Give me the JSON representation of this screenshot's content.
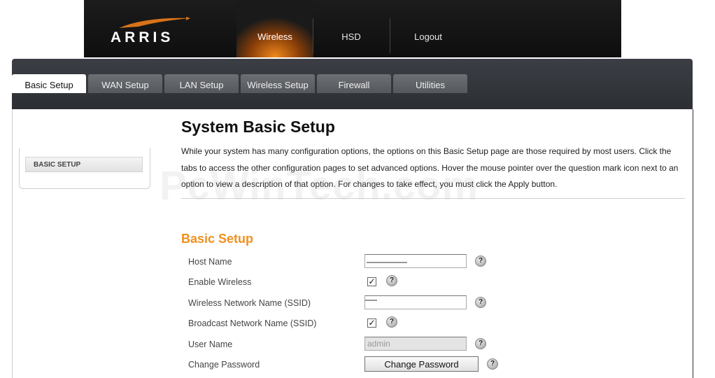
{
  "header": {
    "logo_text": "ARRIS",
    "nav": [
      {
        "label": "Wireless",
        "active": true
      },
      {
        "label": "HSD",
        "active": false
      },
      {
        "label": "Logout",
        "active": false
      }
    ]
  },
  "tabs": [
    {
      "label": "Basic Setup",
      "active": true
    },
    {
      "label": "WAN Setup",
      "active": false
    },
    {
      "label": "LAN Setup",
      "active": false
    },
    {
      "label": "Wireless Setup",
      "active": false
    },
    {
      "label": "Firewall",
      "active": false
    },
    {
      "label": "Utilities",
      "active": false
    }
  ],
  "sidebar": {
    "items": [
      {
        "label": "BASIC SETUP"
      }
    ]
  },
  "main": {
    "title": "System Basic Setup",
    "description": "While your system has many configuration options, the options on this Basic Setup page are those required by most users. Click the tabs to access the other configuration pages to set advanced options. Hover the mouse pointer over the question mark icon next to an option to view a description of that option. For changes to take effect, you must click the Apply button.",
    "watermark": "PcWinTech.com",
    "section_title": "Basic Setup",
    "fields": {
      "host_name": {
        "label": "Host Name",
        "value": ""
      },
      "enable_wireless": {
        "label": "Enable Wireless",
        "checked": true
      },
      "ssid": {
        "label": "Wireless Network Name (SSID)",
        "value": ""
      },
      "broadcast_ssid": {
        "label": "Broadcast Network Name (SSID)",
        "checked": true
      },
      "user_name": {
        "label": "User Name",
        "value": "admin"
      },
      "change_password": {
        "label": "Change Password",
        "button_label": "Change Password"
      }
    },
    "help_glyph": "?",
    "check_glyph": "✓"
  },
  "colors": {
    "accent": "#f0901e",
    "header_bg": "#111111",
    "panel_bg": "#33363b"
  }
}
